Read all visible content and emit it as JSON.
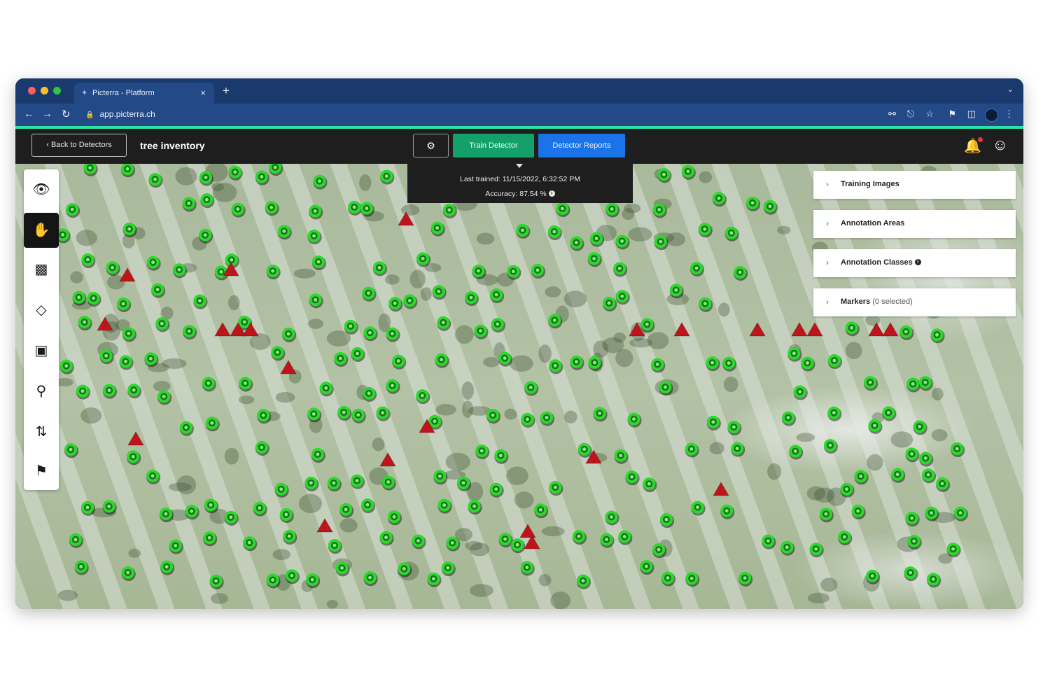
{
  "browser": {
    "tab_title": "Picterra - Platform",
    "tab_close": "×",
    "new_tab": "+",
    "url": "app.picterra.ch",
    "traffic_lights": [
      "#ff5f57",
      "#febc2e",
      "#28c840"
    ],
    "chrome_color": "#1a3a6e",
    "accent_line_color": "#2ee0a6"
  },
  "header": {
    "back_label": "Back to Detectors",
    "title": "tree inventory",
    "train_label": "Train Detector",
    "reports_label": "Detector Reports",
    "train_color": "#13a06a",
    "reports_color": "#1a73e8"
  },
  "training_info": {
    "last_trained": "Last trained: 11/15/2022, 6:32:52 PM",
    "accuracy": "Accuracy: 87.54 %"
  },
  "toolbar": {
    "tools": [
      {
        "name": "visibility",
        "icon": "eye-icon",
        "active": false
      },
      {
        "name": "pan",
        "icon": "hand-icon",
        "active": true
      },
      {
        "name": "rectangle-select",
        "icon": "rectangle-select-icon",
        "active": false
      },
      {
        "name": "polygon",
        "icon": "polygon-icon",
        "active": false
      },
      {
        "name": "area-select",
        "icon": "area-select-icon",
        "active": false
      },
      {
        "name": "zoom-select",
        "icon": "zoom-select-icon",
        "active": false
      },
      {
        "name": "sort",
        "icon": "sort-arrows-icon",
        "active": false
      },
      {
        "name": "flag",
        "icon": "flag-icon",
        "active": false
      }
    ]
  },
  "panel": {
    "items": [
      {
        "label": "Training Images",
        "sub": ""
      },
      {
        "label": "Annotation Areas",
        "sub": ""
      },
      {
        "label": "Annotation Classes",
        "sub": ""
      },
      {
        "label": "Markers",
        "sub": "(0 selected)"
      }
    ]
  },
  "map": {
    "marker_ring_color": "#2bd92b",
    "triangle_color": "#c0141b",
    "marker_icon": "tree-detection-marker-icon",
    "triangle_icon": "missed-tree-triangle-icon"
  }
}
